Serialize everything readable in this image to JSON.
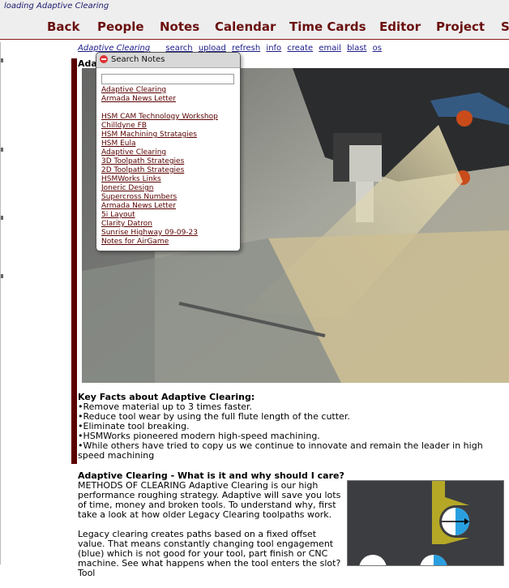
{
  "status": {
    "loading_text": "loading Adaptive Clearing"
  },
  "nav": {
    "items": [
      "Back",
      "People",
      "Notes",
      "Calendar",
      "Time Cards",
      "Editor",
      "Project",
      "S"
    ]
  },
  "toolbar": {
    "crumb": "Adaptive Clearing",
    "actions": [
      "search",
      "upload",
      "refresh",
      "info",
      "create",
      "email",
      "blast",
      "os"
    ]
  },
  "page": {
    "title": "Ada"
  },
  "search_popup": {
    "title": "Search Notes",
    "input_value": "",
    "group1": [
      "Adaptive Clearing",
      "Armada News Letter"
    ],
    "group2": [
      "HSM CAM Technology Workshop",
      "Chilldyne FB",
      "HSM Machining Stratagies",
      "HSM Eula",
      "Adaptive Clearing",
      "3D Toolpath Strategies",
      "2D Toolpath Strategies",
      "HSMWorks Links",
      "Joneric Design",
      "Supercross Numbers",
      "Armada News Letter",
      "5i Layout",
      "Clarity Datron",
      "Sunrise Highway 09-09-23",
      "Notes for AirGame"
    ]
  },
  "key_facts": {
    "heading": "Key Facts about Adaptive Clearing:",
    "bullets": [
      "•Remove material up to 3 times faster.",
      "•Reduce tool wear by using the full flute length of the cutter.",
      "•Eliminate tool breaking.",
      "•HSMWorks pioneered modern high-speed machining.",
      "•While others have tried to copy us we continue to innovate and remain the leader in high speed machining"
    ]
  },
  "what_is": {
    "heading": "Adaptive Clearing - What is it and why should I care?",
    "para1": "METHODS OF CLEARING Adaptive Clearing is our high performance roughing strategy. Adaptive will save you lots of time, money and broken tools. To understand why, first take a look at how older Legacy Clearing toolpaths work.",
    "para2": "Legacy clearing creates paths based on a fixed offset value. That means constantly changing tool engagement (blue) which is not good for your tool, part finish or CNC machine. See what happens when the tool enters the slot? Tool"
  },
  "colors": {
    "nav_text": "#6a0f0f",
    "link": "#5a0000",
    "accent_bar": "#5a0000",
    "diagram_blue": "#2a9fe0",
    "diagram_olive": "#b5a826"
  },
  "icons": {
    "popup_close": "close-icon"
  }
}
